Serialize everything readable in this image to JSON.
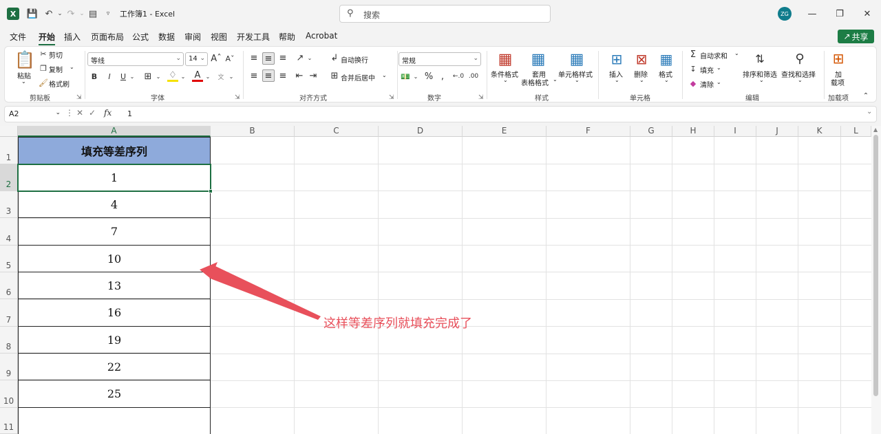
{
  "title_bar": {
    "document_title": "工作簿1 - Excel",
    "search_placeholder": "搜索",
    "avatar_initials": "ZG"
  },
  "tabs": [
    "文件",
    "开始",
    "插入",
    "页面布局",
    "公式",
    "数据",
    "审阅",
    "视图",
    "开发工具",
    "帮助",
    "Acrobat"
  ],
  "active_tab": "开始",
  "share_label": "共享",
  "ribbon": {
    "clipboard": {
      "paste": "粘贴",
      "cut": "剪切",
      "copy": "复制",
      "format_painter": "格式刷",
      "label": "剪贴板"
    },
    "font": {
      "font_name": "等线",
      "font_size": "14",
      "label": "字体",
      "bold": "B",
      "italic": "I",
      "underline": "U"
    },
    "alignment": {
      "wrap_text": "自动换行",
      "merge_center": "合并后居中",
      "label": "对齐方式"
    },
    "number": {
      "format": "常规",
      "label": "数字"
    },
    "styles": {
      "conditional": "条件格式",
      "table_line1": "套用",
      "table_line2": "表格格式",
      "cell_styles": "单元格样式",
      "label": "样式"
    },
    "cells": {
      "insert": "插入",
      "delete": "删除",
      "format": "格式",
      "label": "单元格"
    },
    "editing": {
      "autosum": "自动求和",
      "fill": "填充",
      "clear": "清除",
      "sort_filter": "排序和筛选",
      "find_select": "查找和选择",
      "label": "编辑"
    },
    "addins": {
      "line1": "加",
      "line2": "载项",
      "label": "加载项"
    }
  },
  "formula_bar": {
    "name_box": "A2",
    "fx": "fx",
    "value": "1"
  },
  "columns": [
    "A",
    "B",
    "C",
    "D",
    "E",
    "F",
    "G",
    "H",
    "I",
    "J",
    "K",
    "L"
  ],
  "rows": [
    "1",
    "2",
    "3",
    "4",
    "5",
    "6",
    "7",
    "8",
    "9",
    "10",
    "11"
  ],
  "cells": {
    "header": "填充等差序列",
    "values": [
      "1",
      "4",
      "7",
      "10",
      "13",
      "16",
      "19",
      "22",
      "25"
    ]
  },
  "annotation": "这样等差序列就填充完成了",
  "colors": {
    "excel_green": "#1d6f42",
    "header_fill": "#8eaadb",
    "annotation": "#e8505b"
  }
}
